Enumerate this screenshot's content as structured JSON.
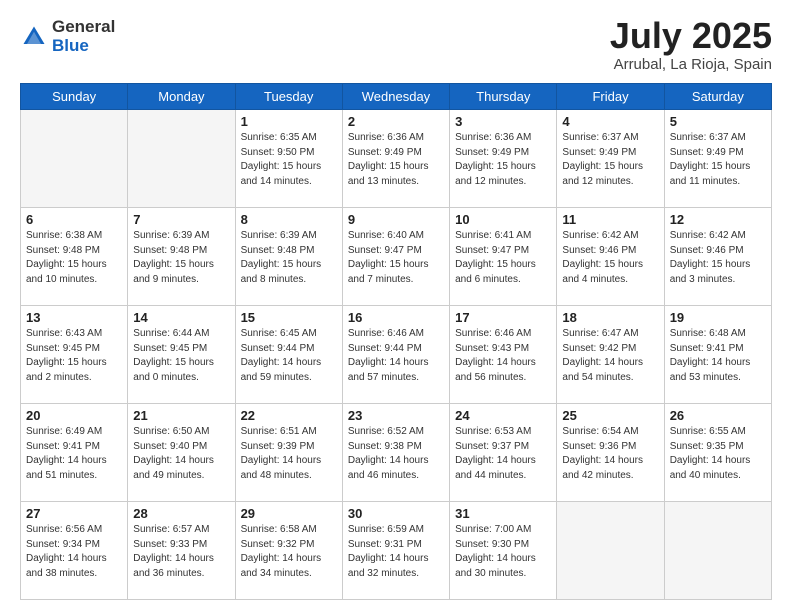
{
  "header": {
    "logo_general": "General",
    "logo_blue": "Blue",
    "month": "July 2025",
    "location": "Arrubal, La Rioja, Spain"
  },
  "days_of_week": [
    "Sunday",
    "Monday",
    "Tuesday",
    "Wednesday",
    "Thursday",
    "Friday",
    "Saturday"
  ],
  "weeks": [
    [
      {
        "day": "",
        "empty": true
      },
      {
        "day": "",
        "empty": true
      },
      {
        "day": "1",
        "sunrise": "6:35 AM",
        "sunset": "9:50 PM",
        "daylight": "15 hours and 14 minutes."
      },
      {
        "day": "2",
        "sunrise": "6:36 AM",
        "sunset": "9:49 PM",
        "daylight": "15 hours and 13 minutes."
      },
      {
        "day": "3",
        "sunrise": "6:36 AM",
        "sunset": "9:49 PM",
        "daylight": "15 hours and 12 minutes."
      },
      {
        "day": "4",
        "sunrise": "6:37 AM",
        "sunset": "9:49 PM",
        "daylight": "15 hours and 12 minutes."
      },
      {
        "day": "5",
        "sunrise": "6:37 AM",
        "sunset": "9:49 PM",
        "daylight": "15 hours and 11 minutes."
      }
    ],
    [
      {
        "day": "6",
        "sunrise": "6:38 AM",
        "sunset": "9:48 PM",
        "daylight": "15 hours and 10 minutes."
      },
      {
        "day": "7",
        "sunrise": "6:39 AM",
        "sunset": "9:48 PM",
        "daylight": "15 hours and 9 minutes."
      },
      {
        "day": "8",
        "sunrise": "6:39 AM",
        "sunset": "9:48 PM",
        "daylight": "15 hours and 8 minutes."
      },
      {
        "day": "9",
        "sunrise": "6:40 AM",
        "sunset": "9:47 PM",
        "daylight": "15 hours and 7 minutes."
      },
      {
        "day": "10",
        "sunrise": "6:41 AM",
        "sunset": "9:47 PM",
        "daylight": "15 hours and 6 minutes."
      },
      {
        "day": "11",
        "sunrise": "6:42 AM",
        "sunset": "9:46 PM",
        "daylight": "15 hours and 4 minutes."
      },
      {
        "day": "12",
        "sunrise": "6:42 AM",
        "sunset": "9:46 PM",
        "daylight": "15 hours and 3 minutes."
      }
    ],
    [
      {
        "day": "13",
        "sunrise": "6:43 AM",
        "sunset": "9:45 PM",
        "daylight": "15 hours and 2 minutes."
      },
      {
        "day": "14",
        "sunrise": "6:44 AM",
        "sunset": "9:45 PM",
        "daylight": "15 hours and 0 minutes."
      },
      {
        "day": "15",
        "sunrise": "6:45 AM",
        "sunset": "9:44 PM",
        "daylight": "14 hours and 59 minutes."
      },
      {
        "day": "16",
        "sunrise": "6:46 AM",
        "sunset": "9:44 PM",
        "daylight": "14 hours and 57 minutes."
      },
      {
        "day": "17",
        "sunrise": "6:46 AM",
        "sunset": "9:43 PM",
        "daylight": "14 hours and 56 minutes."
      },
      {
        "day": "18",
        "sunrise": "6:47 AM",
        "sunset": "9:42 PM",
        "daylight": "14 hours and 54 minutes."
      },
      {
        "day": "19",
        "sunrise": "6:48 AM",
        "sunset": "9:41 PM",
        "daylight": "14 hours and 53 minutes."
      }
    ],
    [
      {
        "day": "20",
        "sunrise": "6:49 AM",
        "sunset": "9:41 PM",
        "daylight": "14 hours and 51 minutes."
      },
      {
        "day": "21",
        "sunrise": "6:50 AM",
        "sunset": "9:40 PM",
        "daylight": "14 hours and 49 minutes."
      },
      {
        "day": "22",
        "sunrise": "6:51 AM",
        "sunset": "9:39 PM",
        "daylight": "14 hours and 48 minutes."
      },
      {
        "day": "23",
        "sunrise": "6:52 AM",
        "sunset": "9:38 PM",
        "daylight": "14 hours and 46 minutes."
      },
      {
        "day": "24",
        "sunrise": "6:53 AM",
        "sunset": "9:37 PM",
        "daylight": "14 hours and 44 minutes."
      },
      {
        "day": "25",
        "sunrise": "6:54 AM",
        "sunset": "9:36 PM",
        "daylight": "14 hours and 42 minutes."
      },
      {
        "day": "26",
        "sunrise": "6:55 AM",
        "sunset": "9:35 PM",
        "daylight": "14 hours and 40 minutes."
      }
    ],
    [
      {
        "day": "27",
        "sunrise": "6:56 AM",
        "sunset": "9:34 PM",
        "daylight": "14 hours and 38 minutes."
      },
      {
        "day": "28",
        "sunrise": "6:57 AM",
        "sunset": "9:33 PM",
        "daylight": "14 hours and 36 minutes."
      },
      {
        "day": "29",
        "sunrise": "6:58 AM",
        "sunset": "9:32 PM",
        "daylight": "14 hours and 34 minutes."
      },
      {
        "day": "30",
        "sunrise": "6:59 AM",
        "sunset": "9:31 PM",
        "daylight": "14 hours and 32 minutes."
      },
      {
        "day": "31",
        "sunrise": "7:00 AM",
        "sunset": "9:30 PM",
        "daylight": "14 hours and 30 minutes."
      },
      {
        "day": "",
        "empty": true
      },
      {
        "day": "",
        "empty": true
      }
    ]
  ]
}
